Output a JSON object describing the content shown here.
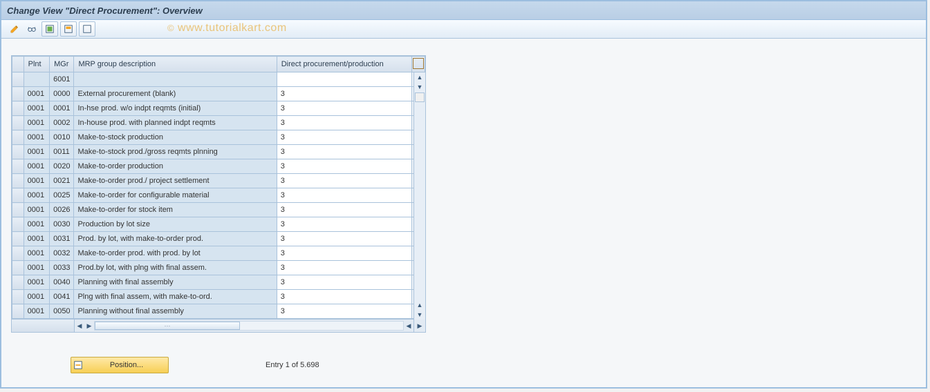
{
  "window": {
    "title": "Change View \"Direct Procurement\": Overview"
  },
  "toolbar": {
    "items": [
      {
        "name": "other-view",
        "glyph": "pencil"
      },
      {
        "name": "glasses",
        "glyph": "glasses"
      },
      {
        "name": "select-all",
        "glyph": "grid-green"
      },
      {
        "name": "select-block",
        "glyph": "grid-orange"
      },
      {
        "name": "deselect-all",
        "glyph": "grid-empty"
      }
    ]
  },
  "watermark": {
    "copy": "©",
    "text": "www.tutorialkart.com"
  },
  "table": {
    "headers": {
      "plnt": "Plnt",
      "mgr": "MGr",
      "desc": "MRP group description",
      "dp": "Direct procurement/production"
    },
    "rows": [
      {
        "plnt": "",
        "mgr": "6001",
        "desc": "",
        "dp": ""
      },
      {
        "plnt": "0001",
        "mgr": "0000",
        "desc": "External procurement            (blank)",
        "dp": "3"
      },
      {
        "plnt": "0001",
        "mgr": "0001",
        "desc": "In-hse prod. w/o indpt reqmts (initial)",
        "dp": "3"
      },
      {
        "plnt": "0001",
        "mgr": "0002",
        "desc": "In-house prod. with planned indpt reqmts",
        "dp": "3"
      },
      {
        "plnt": "0001",
        "mgr": "0010",
        "desc": "Make-to-stock production",
        "dp": "3"
      },
      {
        "plnt": "0001",
        "mgr": "0011",
        "desc": "Make-to-stock prod./gross reqmts plnning",
        "dp": "3"
      },
      {
        "plnt": "0001",
        "mgr": "0020",
        "desc": "Make-to-order production",
        "dp": "3"
      },
      {
        "plnt": "0001",
        "mgr": "0021",
        "desc": "Make-to-order prod./ project settlement",
        "dp": "3"
      },
      {
        "plnt": "0001",
        "mgr": "0025",
        "desc": "Make-to-order for configurable material",
        "dp": "3"
      },
      {
        "plnt": "0001",
        "mgr": "0026",
        "desc": "Make-to-order for stock item",
        "dp": "3"
      },
      {
        "plnt": "0001",
        "mgr": "0030",
        "desc": "Production by lot size",
        "dp": "3"
      },
      {
        "plnt": "0001",
        "mgr": "0031",
        "desc": "Prod. by lot, with make-to-order prod.",
        "dp": "3"
      },
      {
        "plnt": "0001",
        "mgr": "0032",
        "desc": "Make-to-order prod. with prod. by lot",
        "dp": "3"
      },
      {
        "plnt": "0001",
        "mgr": "0033",
        "desc": "Prod.by lot, with plng with final assem.",
        "dp": "3"
      },
      {
        "plnt": "0001",
        "mgr": "0040",
        "desc": "Planning with final assembly",
        "dp": "3"
      },
      {
        "plnt": "0001",
        "mgr": "0041",
        "desc": "Plng with final assem, with make-to-ord.",
        "dp": "3"
      },
      {
        "plnt": "0001",
        "mgr": "0050",
        "desc": "Planning without final assembly",
        "dp": "3"
      }
    ]
  },
  "footer": {
    "position_button": "Position...",
    "entry_status": "Entry 1 of 5.698"
  }
}
